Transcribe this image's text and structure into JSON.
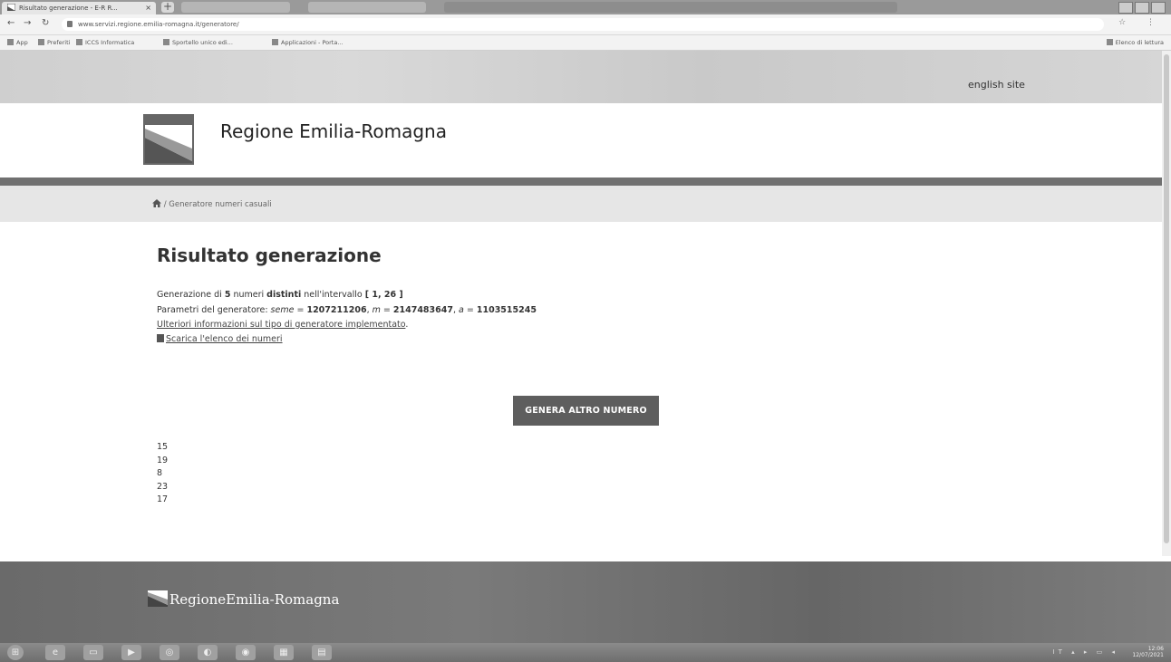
{
  "browser": {
    "tab_title": "Risultato generazione - E-R R...",
    "url": "www.servizi.regione.emilia-romagna.it/generatore/",
    "bookmarks": [
      "App",
      "Preferiti",
      "ICCS Informatica",
      "Sportello unico edi...",
      "Applicazioni - Porta..."
    ],
    "reading_list": "Elenco di lettura"
  },
  "header": {
    "english_link": "english site",
    "site_title": "Regione Emilia-Romagna"
  },
  "breadcrumb": {
    "separator": "/",
    "current": "Generatore numeri casuali"
  },
  "main": {
    "title": "Risultato generazione",
    "summary": {
      "p1": "Generazione di ",
      "count": "5",
      "p2": " numeri ",
      "distinct": "distinti",
      "p3": " nell'intervallo ",
      "range": "[ 1, 26 ]"
    },
    "params": {
      "p1": "Parametri del generatore: ",
      "seed_label": "seme",
      "eq": " = ",
      "seed": "1207211206",
      "sep": ", ",
      "m_label": "m",
      "m": "2147483647",
      "a_label": "a",
      "a": "1103515245"
    },
    "info_link": "Ulteriori informazioni sul tipo di generatore implementato",
    "download_link": "Scarica l'elenco dei numeri",
    "generate_button": "GENERA ALTRO NUMERO",
    "numbers": [
      "15",
      "19",
      "8",
      "23",
      "17"
    ]
  },
  "footer": {
    "logo_text": "RegioneEmilia-Romagna"
  },
  "taskbar": {
    "time": "12:06",
    "date": "12/07/2021",
    "lang": "IT"
  },
  "colors": {
    "button": "#5e5e5e",
    "footer": "#707070",
    "breadcrumb_bg": "#e6e6e6"
  }
}
